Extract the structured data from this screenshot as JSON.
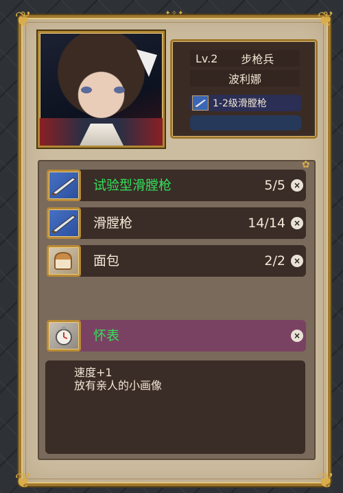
{
  "character": {
    "level": "Lv.2",
    "class": "步枪兵",
    "name": "波利娜",
    "weapon": "1-2级滑膛枪"
  },
  "inventory": [
    {
      "name": "试验型滑膛枪",
      "count": "5/5",
      "icon": "musket-icon",
      "highlight": true
    },
    {
      "name": "滑膛枪",
      "count": "14/14",
      "icon": "musket-icon",
      "highlight": false
    },
    {
      "name": "面包",
      "count": "2/2",
      "icon": "bread-icon",
      "highlight": false
    }
  ],
  "accessory": {
    "name": "怀表",
    "icon": "pocket-watch-icon"
  },
  "description": {
    "line1": "速度+1",
    "line2": "放有亲人的小画像"
  },
  "remove_glyph": "×",
  "colors": {
    "highlight_text": "#33e05c",
    "accessory_row": "#7a4262",
    "frame_gold": "#b88a36"
  }
}
